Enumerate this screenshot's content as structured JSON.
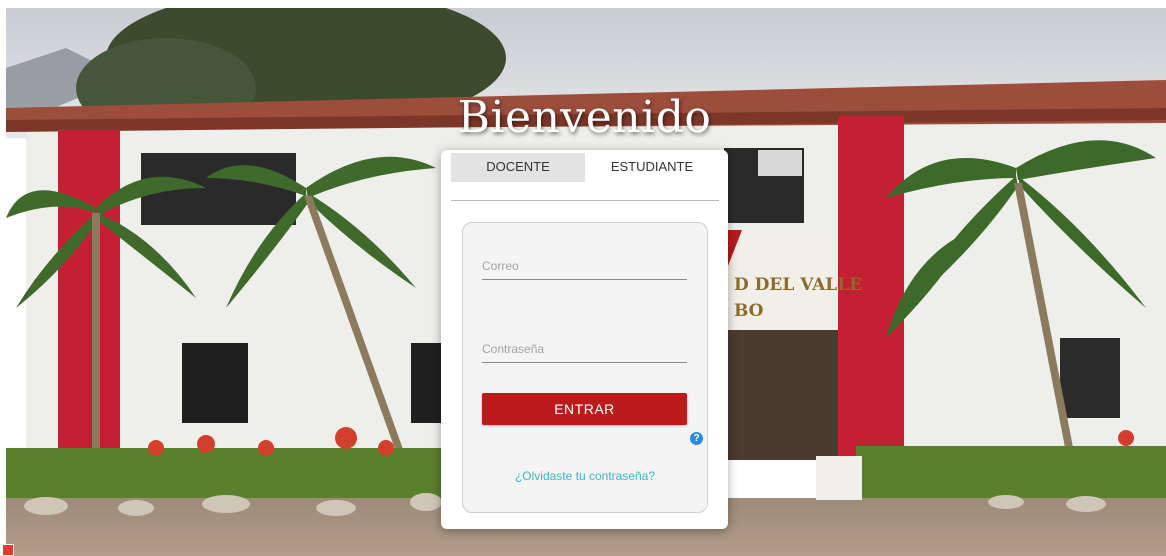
{
  "background": {
    "sign_text_line1": "D DEL VALLE",
    "sign_text_line2": "BO"
  },
  "header": {
    "welcome_title": "Bienvenido"
  },
  "tabs": [
    {
      "label": "DOCENTE",
      "active": false
    },
    {
      "label": "ESTUDIANTE",
      "active": true
    }
  ],
  "form": {
    "email": {
      "placeholder": "Correo",
      "value": ""
    },
    "password": {
      "placeholder": "Contraseña",
      "value": ""
    },
    "submit_label": "ENTRAR",
    "help_icon": "question-circle-icon",
    "help_symbol": "?",
    "forgot_link": "¿Olvidaste tu contraseña?"
  },
  "colors": {
    "accent_red": "#bb1b1b",
    "link_teal": "#3bb5c9",
    "help_blue": "#2d8ae2"
  }
}
